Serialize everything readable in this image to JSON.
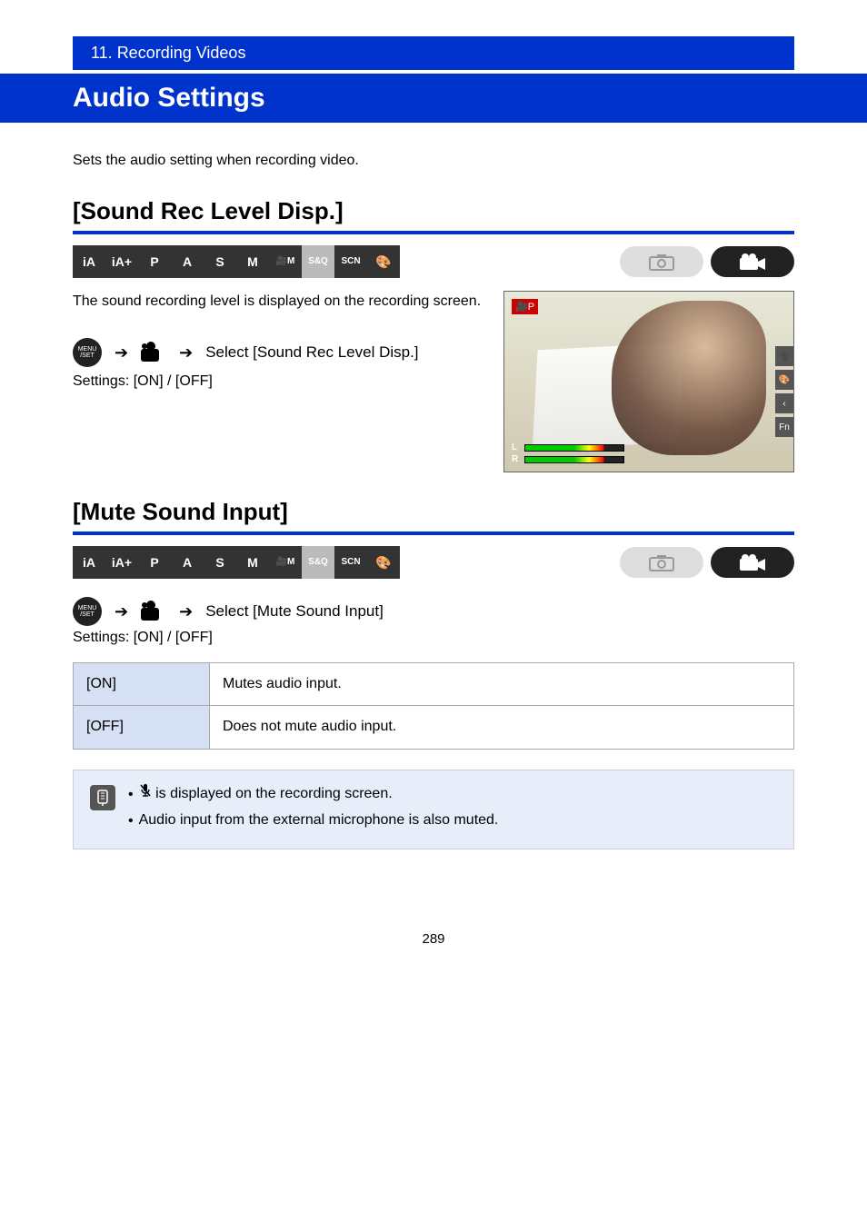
{
  "header": {
    "breadcrumb": "11. Recording Videos"
  },
  "title": "Audio Settings",
  "intro": "Sets the audio setting when recording video.",
  "sections": {
    "soundRec": {
      "title": "[Sound Rec Level Disp.]",
      "body": "The sound recording level is displayed on the recording screen.",
      "menu_label": "Select [Sound Rec Level Disp.]",
      "settings": "Settings: [ON] / [OFF]"
    },
    "muteSound": {
      "title": "[Mute Sound Input]",
      "menu_label": "Select [Mute Sound Input]",
      "settings": "Settings: [ON] / [OFF]",
      "table": [
        {
          "left": "[ON]",
          "right": "Mutes audio input."
        },
        {
          "left": "[OFF]",
          "right": "Does not mute audio input."
        }
      ],
      "notes": [
        {
          "text_pre": "",
          "icon": "mic-off",
          "text_post": " is displayed on the recording screen."
        },
        {
          "text_pre": "Audio input from the external microphone is also muted.",
          "icon": null,
          "text_post": ""
        }
      ]
    }
  },
  "modes": {
    "row": [
      {
        "label": "iA",
        "active": true
      },
      {
        "label": "iA+",
        "active": true
      },
      {
        "label": "P",
        "active": true
      },
      {
        "label": "A",
        "active": true
      },
      {
        "label": "S",
        "active": true
      },
      {
        "label": "M",
        "active": true
      },
      {
        "label": "🎥M",
        "active": true
      },
      {
        "label": "S&Q",
        "active": false
      },
      {
        "label": "SCN",
        "active": true
      },
      {
        "label": "🎨",
        "active": true
      }
    ]
  },
  "menu_btn": {
    "line1": "MENU",
    "line2": "/SET"
  },
  "footer": {
    "page": "289"
  }
}
